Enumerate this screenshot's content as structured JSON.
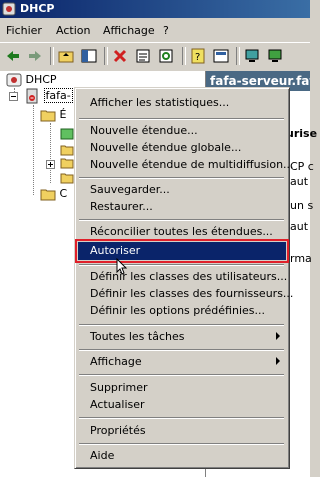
{
  "title": "DHCP",
  "menubar": [
    "Fichier",
    "Action",
    "Affichage",
    "?"
  ],
  "tree": {
    "root": "DHCP",
    "server": "fafa-",
    "scope_label": "É",
    "options_label": "C"
  },
  "right_pane": {
    "header": "fafa-serveur.fafa.",
    "lines": [
      "urise",
      "CP c",
      "aut",
      "un s",
      "aut",
      "rma"
    ]
  },
  "context_menu": {
    "items": [
      {
        "label": "Afficher les statistiques...",
        "submenu": false,
        "selected": false
      },
      {
        "label": "Nouvelle étendue...",
        "submenu": false,
        "selected": false
      },
      {
        "label": "Nouvelle étendue globale...",
        "submenu": false,
        "selected": false
      },
      {
        "label": "Nouvelle étendue de multidiffusion...",
        "submenu": false,
        "selected": false
      },
      {
        "label": "Sauvegarder...",
        "submenu": false,
        "selected": false
      },
      {
        "label": "Restaurer...",
        "submenu": false,
        "selected": false
      },
      {
        "label": "Réconcilier toutes les étendues...",
        "submenu": false,
        "selected": false
      },
      {
        "label": "Autoriser",
        "submenu": false,
        "selected": true
      },
      {
        "label": "Définir les classes des utilisateurs...",
        "submenu": false,
        "selected": false
      },
      {
        "label": "Définir les classes des fournisseurs...",
        "submenu": false,
        "selected": false
      },
      {
        "label": "Définir les options prédéfinies...",
        "submenu": false,
        "selected": false
      },
      {
        "label": "Toutes les tâches",
        "submenu": true,
        "selected": false
      },
      {
        "label": "Affichage",
        "submenu": true,
        "selected": false
      },
      {
        "label": "Supprimer",
        "submenu": false,
        "selected": false
      },
      {
        "label": "Actualiser",
        "submenu": false,
        "selected": false
      },
      {
        "label": "Propriétés",
        "submenu": false,
        "selected": false
      },
      {
        "label": "Aide",
        "submenu": false,
        "selected": false
      }
    ]
  },
  "colors": {
    "selection": "#0a246a",
    "highlight_border": "#e0202a",
    "title_bar": "#0a246a"
  }
}
